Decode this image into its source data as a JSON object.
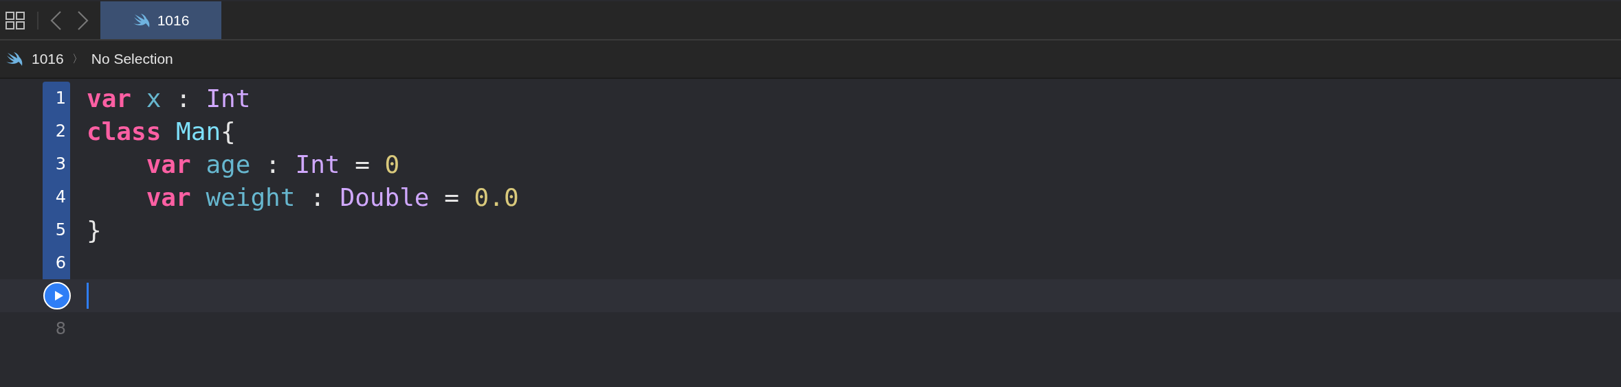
{
  "tabs": [
    {
      "label": "1016",
      "selected": true
    }
  ],
  "breadcrumb": {
    "items": [
      "1016",
      "No Selection"
    ],
    "separator": "〉"
  },
  "editor": {
    "lines": [
      {
        "number": "1",
        "in_range": true,
        "current": false,
        "kind": "number",
        "tokens": [
          {
            "text": "var",
            "color": "#fc5fa3",
            "kind": "keyword"
          },
          {
            "text": " x",
            "color": "#67b7cf",
            "kind": "name"
          },
          {
            "text": " : ",
            "color": "#e6e6e6",
            "kind": "name"
          },
          {
            "text": "Int",
            "color": "#d0a8ff",
            "kind": "name"
          }
        ]
      },
      {
        "number": "2",
        "in_range": true,
        "current": false,
        "kind": "number",
        "tokens": [
          {
            "text": "class",
            "color": "#fc5fa3",
            "kind": "keyword"
          },
          {
            "text": " Man",
            "color": "#7ee0fb",
            "kind": "name"
          },
          {
            "text": "{",
            "color": "#e6e6e6",
            "kind": "name"
          }
        ]
      },
      {
        "number": "3",
        "in_range": true,
        "current": false,
        "kind": "number",
        "tokens": [
          {
            "text": "    var",
            "color": "#fc5fa3",
            "kind": "keyword"
          },
          {
            "text": " age",
            "color": "#67b7cf",
            "kind": "name"
          },
          {
            "text": " : ",
            "color": "#e6e6e6",
            "kind": "name"
          },
          {
            "text": "Int",
            "color": "#d0a8ff",
            "kind": "name"
          },
          {
            "text": " = ",
            "color": "#e6e6e6",
            "kind": "name"
          },
          {
            "text": "0",
            "color": "#d9c97c",
            "kind": "name"
          }
        ]
      },
      {
        "number": "4",
        "in_range": true,
        "current": false,
        "kind": "number",
        "tokens": [
          {
            "text": "    var",
            "color": "#fc5fa3",
            "kind": "keyword"
          },
          {
            "text": " weight",
            "color": "#67b7cf",
            "kind": "name"
          },
          {
            "text": " : ",
            "color": "#e6e6e6",
            "kind": "name"
          },
          {
            "text": "Double",
            "color": "#d0a8ff",
            "kind": "name"
          },
          {
            "text": " = ",
            "color": "#e6e6e6",
            "kind": "name"
          },
          {
            "text": "0.0",
            "color": "#d9c97c",
            "kind": "name"
          }
        ]
      },
      {
        "number": "5",
        "in_range": true,
        "current": false,
        "kind": "number",
        "tokens": [
          {
            "text": "}",
            "color": "#e6e6e6",
            "kind": "name"
          }
        ]
      },
      {
        "number": "6",
        "in_range": true,
        "current": false,
        "kind": "number"
      },
      {
        "in_range": false,
        "current": true,
        "kind": "run"
      },
      {
        "number": "8",
        "in_range": false,
        "current": false,
        "kind": "number"
      }
    ]
  }
}
